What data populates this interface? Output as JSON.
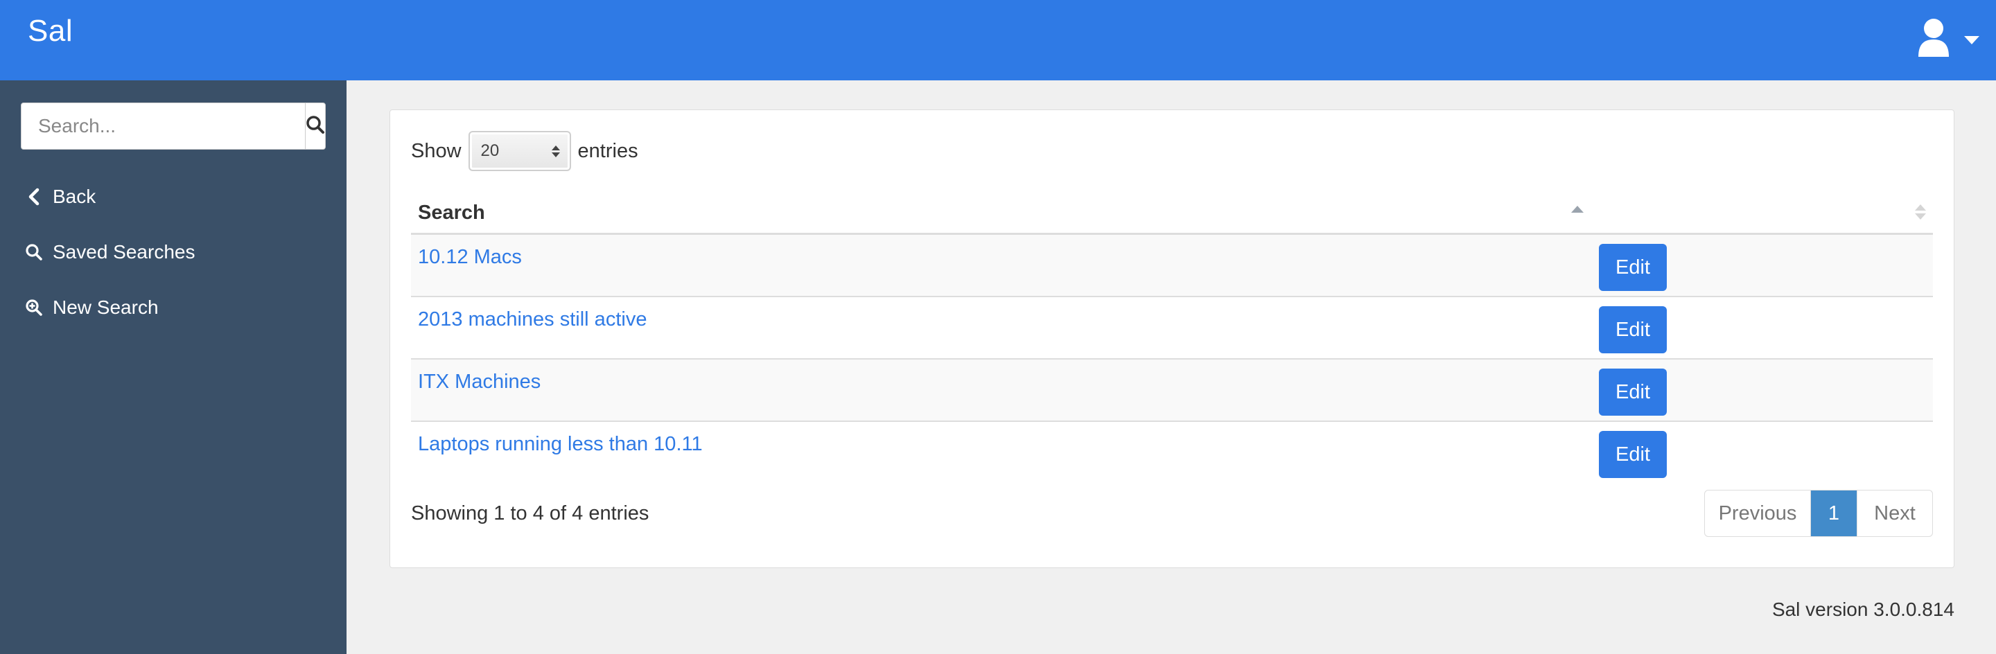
{
  "header": {
    "brand": "Sal",
    "user_icon": "user-icon",
    "caret_icon": "caret-down-icon"
  },
  "sidebar": {
    "search_placeholder": "Search...",
    "search_button_icon": "search-icon",
    "items": [
      {
        "label": "Back",
        "icon": "chevron-left-icon"
      },
      {
        "label": "Saved Searches",
        "icon": "search-icon"
      },
      {
        "label": "New Search",
        "icon": "zoom-in-icon"
      }
    ]
  },
  "table_controls": {
    "show_label": "Show",
    "page_length": "20",
    "entries_label": "entries"
  },
  "table": {
    "columns": [
      "Search",
      ""
    ],
    "rows": [
      {
        "name": "10.12 Macs",
        "action": "Edit"
      },
      {
        "name": "2013 machines still active",
        "action": "Edit"
      },
      {
        "name": "ITX Machines",
        "action": "Edit"
      },
      {
        "name": "Laptops running less than 10.11",
        "action": "Edit"
      }
    ]
  },
  "pagination": {
    "info": "Showing 1 to 4 of 4 entries",
    "previous": "Previous",
    "current_page": "1",
    "next": "Next"
  },
  "footer": {
    "version": "Sal version 3.0.0.814"
  },
  "colors": {
    "navbar": "#2f7ae5",
    "sidebar": "#3a5068",
    "accent": "#2f7ae5",
    "active_page": "#428bca"
  }
}
